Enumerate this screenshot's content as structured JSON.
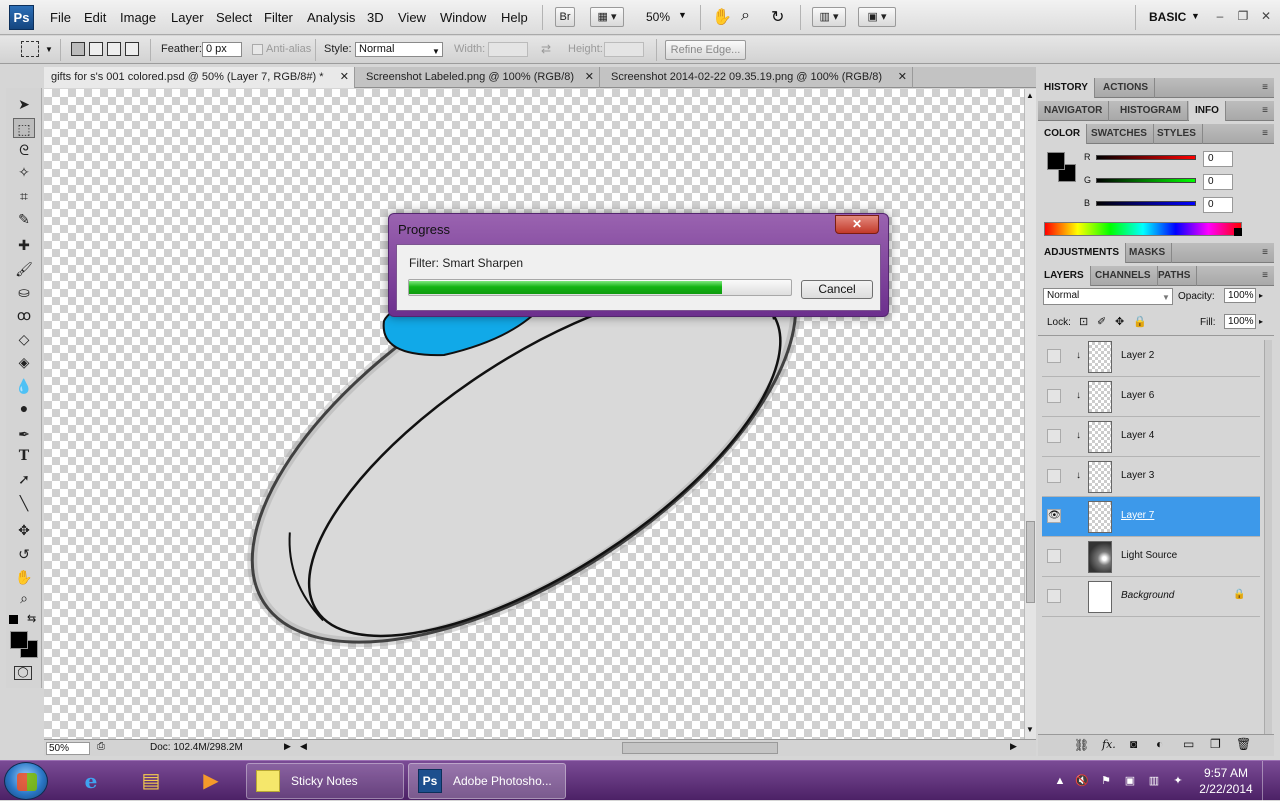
{
  "app": {
    "logo": "Ps"
  },
  "menu": [
    "File",
    "Edit",
    "Image",
    "Layer",
    "Select",
    "Filter",
    "Analysis",
    "3D",
    "View",
    "Window",
    "Help"
  ],
  "appbar": {
    "bridge_label": "Br",
    "zoom": "50%",
    "workspace": "BASIC"
  },
  "options": {
    "feather_label": "Feather:",
    "feather_value": "0 px",
    "antialias_label": "Anti-alias",
    "style_label": "Style:",
    "style_value": "Normal",
    "width_label": "Width:",
    "height_label": "Height:",
    "refine_edge": "Refine Edge..."
  },
  "tabs": [
    {
      "label": "gifts for s's 001 colored.psd @ 50% (Layer 7, RGB/8#) *",
      "close": "✕"
    },
    {
      "label": "Screenshot Labeled.png @ 100% (RGB/8)",
      "close": "✕"
    },
    {
      "label": "Screenshot 2014-02-22 09.35.19.png @ 100% (RGB/8)",
      "close": "✕"
    }
  ],
  "status": {
    "zoom": "50%",
    "doc_info": "Doc: 102.4M/298.2M"
  },
  "dialog": {
    "title": "Progress",
    "message": "Filter: Smart Sharpen",
    "progress_fraction": 0.82,
    "cancel": "Cancel",
    "close": "✕"
  },
  "panels": {
    "row1": [
      "HISTORY",
      "ACTIONS"
    ],
    "row2": [
      "NAVIGATOR",
      "HISTOGRAM",
      "INFO"
    ],
    "row3": [
      "COLOR",
      "SWATCHES",
      "STYLES"
    ],
    "row4": [
      "ADJUSTMENTS",
      "MASKS"
    ],
    "row5": [
      "LAYERS",
      "CHANNELS",
      "PATHS"
    ]
  },
  "color": {
    "r_label": "R",
    "g_label": "G",
    "b_label": "B",
    "r": "0",
    "g": "0",
    "b": "0"
  },
  "layers_panel": {
    "blend_mode": "Normal",
    "opacity_label": "Opacity:",
    "opacity": "100%",
    "lock_label": "Lock:",
    "fill_label": "Fill:",
    "fill": "100%",
    "items": [
      {
        "name": "Layer 2",
        "visible": false,
        "clipped": true,
        "selected": false
      },
      {
        "name": "Layer 6",
        "visible": false,
        "clipped": true,
        "selected": false
      },
      {
        "name": "Layer 4",
        "visible": false,
        "clipped": true,
        "selected": false
      },
      {
        "name": "Layer 3",
        "visible": false,
        "clipped": true,
        "selected": false
      },
      {
        "name": "Layer 7",
        "visible": true,
        "clipped": false,
        "selected": true
      },
      {
        "name": "Light Source",
        "visible": false,
        "clipped": false,
        "selected": false
      },
      {
        "name": "Background",
        "visible": false,
        "clipped": false,
        "selected": false,
        "locked": true
      }
    ]
  },
  "taskbar": {
    "sticky_notes": "Sticky Notes",
    "photoshop": "Adobe Photosho...",
    "time": "9:57 AM",
    "date": "2/22/2014"
  },
  "colors": {
    "selected_layer": "#3d99ea",
    "dialog_frame": "#7a3f98",
    "taskbar": "#5e2f7c",
    "gem": "#11a9e8"
  }
}
